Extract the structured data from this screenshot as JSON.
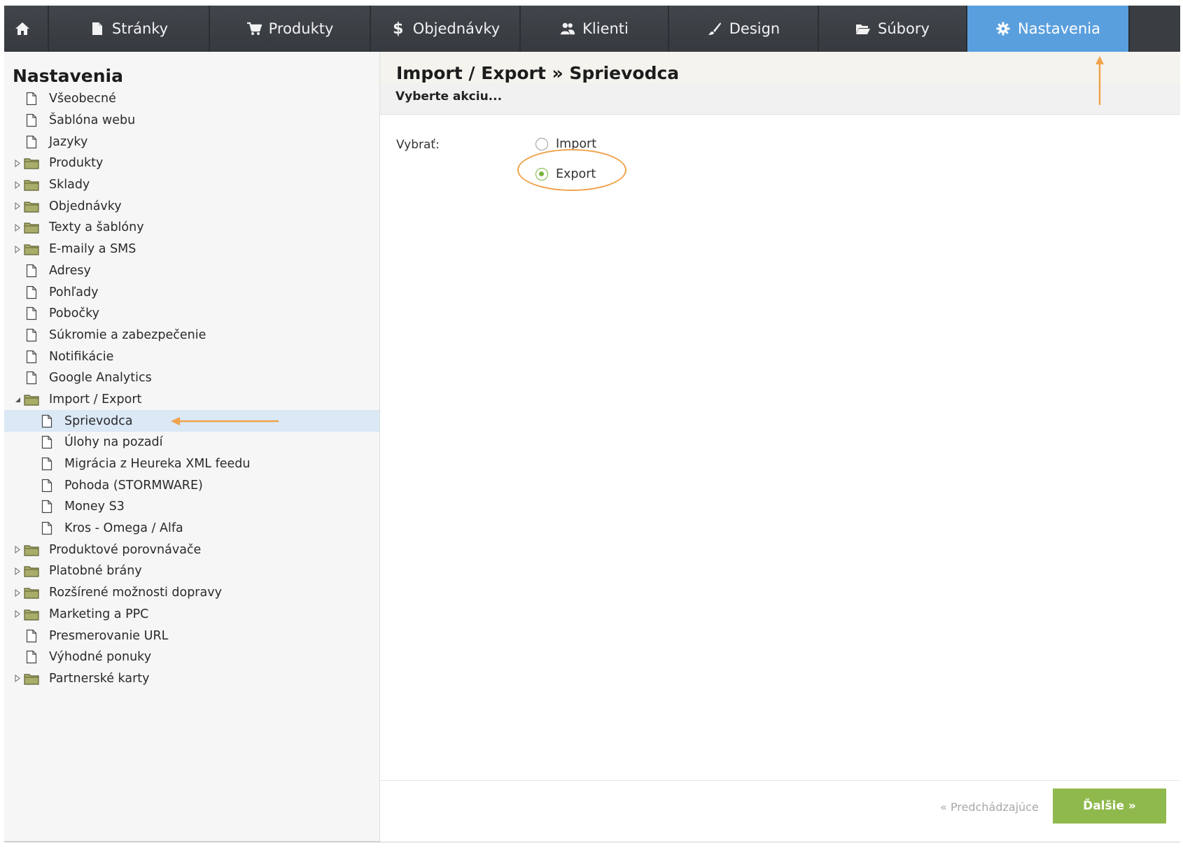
{
  "nav": {
    "tabs": [
      {
        "label": "",
        "icon": "home-icon"
      },
      {
        "label": "Stránky",
        "icon": "page-icon"
      },
      {
        "label": "Produkty",
        "icon": "cart-icon"
      },
      {
        "label": "Objednávky",
        "icon": "dollar-icon"
      },
      {
        "label": "Klienti",
        "icon": "users-icon"
      },
      {
        "label": "Design",
        "icon": "brush-icon"
      },
      {
        "label": "Súbory",
        "icon": "folder-open-icon"
      },
      {
        "label": "Nastavenia",
        "icon": "gear-icon"
      }
    ],
    "active_tab": "Nastavenia"
  },
  "sidebar": {
    "title": "Nastavenia",
    "items": [
      {
        "label": "Všeobecné",
        "type": "page"
      },
      {
        "label": "Šablóna webu",
        "type": "page"
      },
      {
        "label": "Jazyky",
        "type": "page"
      },
      {
        "label": "Produkty",
        "type": "folder"
      },
      {
        "label": "Sklady",
        "type": "folder"
      },
      {
        "label": "Objednávky",
        "type": "folder"
      },
      {
        "label": "Texty a šablóny",
        "type": "folder"
      },
      {
        "label": "E-maily a SMS",
        "type": "folder"
      },
      {
        "label": "Adresy",
        "type": "page"
      },
      {
        "label": "Pohľady",
        "type": "page"
      },
      {
        "label": "Pobočky",
        "type": "page"
      },
      {
        "label": "Súkromie a zabezpečenie",
        "type": "page"
      },
      {
        "label": "Notifikácie",
        "type": "page"
      },
      {
        "label": "Google Analytics",
        "type": "page"
      },
      {
        "label": "Import / Export",
        "type": "folder",
        "expanded": true
      },
      {
        "label": "Sprievodca",
        "type": "page",
        "child": true,
        "selected": true
      },
      {
        "label": "Úlohy na pozadí",
        "type": "page",
        "child": true
      },
      {
        "label": "Migrácia z Heureka XML feedu",
        "type": "page",
        "child": true
      },
      {
        "label": "Pohoda (STORMWARE)",
        "type": "page",
        "child": true
      },
      {
        "label": "Money S3",
        "type": "page",
        "child": true
      },
      {
        "label": "Kros - Omega / Alfa",
        "type": "page",
        "child": true
      },
      {
        "label": "Produktové porovnávače",
        "type": "folder"
      },
      {
        "label": "Platobné brány",
        "type": "folder"
      },
      {
        "label": "Rozšírené možnosti dopravy",
        "type": "folder"
      },
      {
        "label": "Marketing a PPC",
        "type": "folder"
      },
      {
        "label": "Presmerovanie URL",
        "type": "page"
      },
      {
        "label": "Výhodné ponuky",
        "type": "page"
      },
      {
        "label": "Partnerské karty",
        "type": "folder"
      }
    ]
  },
  "main": {
    "title": "Import / Export » Sprievodca",
    "subtitle": "Vyberte akciu...",
    "form": {
      "select_label": "Vybrať:",
      "options": [
        {
          "label": "Import",
          "checked": false
        },
        {
          "label": "Export",
          "checked": true
        }
      ]
    },
    "footer": {
      "prev_label": "« Predchádzajúce",
      "next_label": "Ďalšie »"
    }
  },
  "colors": {
    "nav_bg": "#3a3e43",
    "nav_active": "#5a9fdd",
    "accent_green": "#8fb94c",
    "annotation_orange": "#f0a34b",
    "selected_row": "#dbe8f6"
  }
}
